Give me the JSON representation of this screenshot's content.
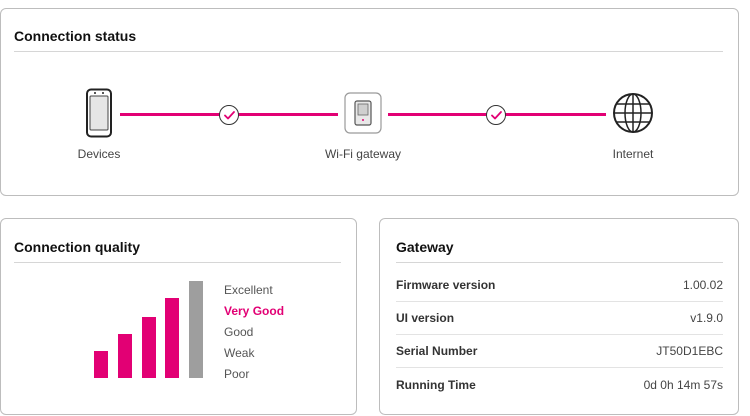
{
  "status": {
    "title": "Connection status",
    "nodes": [
      {
        "label": "Devices",
        "icon": "smartphone-icon"
      },
      {
        "label": "Wi-Fi gateway",
        "icon": "gateway-icon"
      },
      {
        "label": "Internet",
        "icon": "globe-icon"
      }
    ],
    "link_icon": "check-circle-icon"
  },
  "quality": {
    "title": "Connection quality",
    "levels": [
      "Excellent",
      "Very Good",
      "Good",
      "Weak",
      "Poor"
    ],
    "active_level": "Very Good",
    "signal_bars_filled": 4,
    "signal_bars_total": 5
  },
  "gateway": {
    "title": "Gateway",
    "rows": [
      {
        "label": "Firmware version",
        "value": "1.00.02"
      },
      {
        "label": "UI version",
        "value": "v1.9.0"
      },
      {
        "label": "Serial Number",
        "value": "JT50D1EBC"
      },
      {
        "label": "Running Time",
        "value": "0d 0h 14m 57s"
      }
    ]
  },
  "colors": {
    "accent": "#e20074",
    "inactive_bar": "#9e9e9e",
    "border": "#bdbdbd"
  }
}
